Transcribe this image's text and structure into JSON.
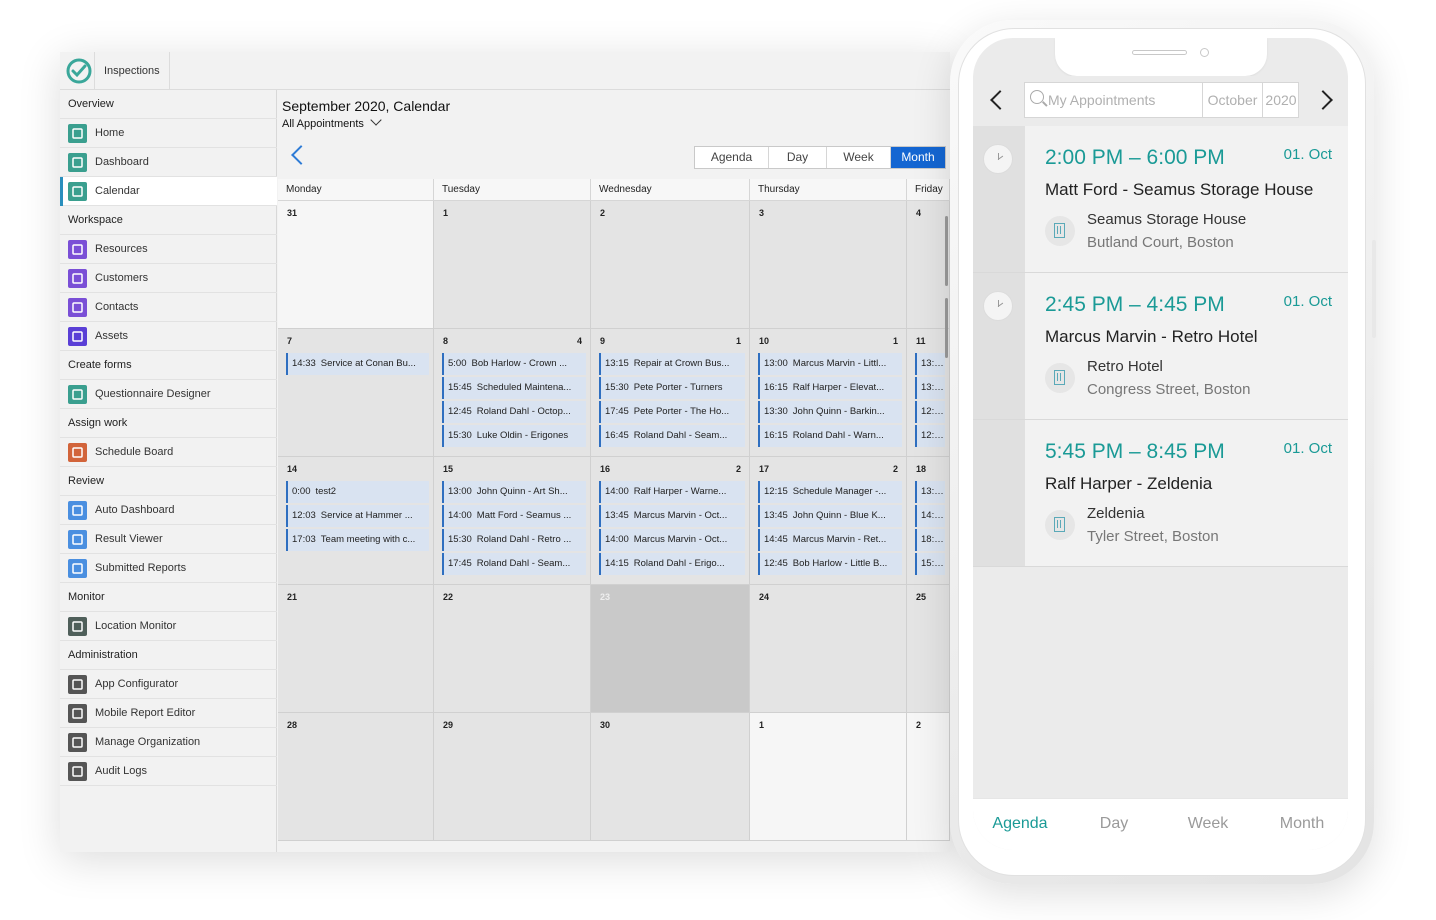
{
  "app": {
    "tab_label": "Inspections"
  },
  "sidebar": {
    "rows": [
      {
        "type": "section",
        "label": "Overview"
      },
      {
        "type": "item",
        "label": "Home",
        "icon": "home-icon",
        "color": "#3a9f8f"
      },
      {
        "type": "item",
        "label": "Dashboard",
        "icon": "dashboard-icon",
        "color": "#3a9f8f"
      },
      {
        "type": "item",
        "label": "Calendar",
        "icon": "calendar-icon",
        "color": "#3a9f8f",
        "active": true
      },
      {
        "type": "section",
        "label": "Workspace"
      },
      {
        "type": "item",
        "label": "Resources",
        "icon": "resources-icon",
        "color": "#7a4fd6"
      },
      {
        "type": "item",
        "label": "Customers",
        "icon": "customers-icon",
        "color": "#7a4fd6"
      },
      {
        "type": "item",
        "label": "Contacts",
        "icon": "contacts-icon",
        "color": "#7a4fd6"
      },
      {
        "type": "item",
        "label": "Assets",
        "icon": "assets-icon",
        "color": "#5a3fd6"
      },
      {
        "type": "section",
        "label": "Create forms"
      },
      {
        "type": "item",
        "label": "Questionnaire Designer",
        "icon": "questionnaire-icon",
        "color": "#3a9f8f"
      },
      {
        "type": "section",
        "label": "Assign work"
      },
      {
        "type": "item",
        "label": "Schedule Board",
        "icon": "schedule-board-icon",
        "color": "#d2643a"
      },
      {
        "type": "section",
        "label": "Review"
      },
      {
        "type": "item",
        "label": "Auto Dashboard",
        "icon": "auto-dashboard-icon",
        "color": "#4a8fe0"
      },
      {
        "type": "item",
        "label": "Result Viewer",
        "icon": "result-viewer-icon",
        "color": "#4a8fe0"
      },
      {
        "type": "item",
        "label": "Submitted Reports",
        "icon": "submitted-reports-icon",
        "color": "#4a8fe0"
      },
      {
        "type": "section",
        "label": "Monitor"
      },
      {
        "type": "item",
        "label": "Location Monitor",
        "icon": "location-monitor-icon",
        "color": "#4f5f5a"
      },
      {
        "type": "section",
        "label": "Administration"
      },
      {
        "type": "item",
        "label": "App Configurator",
        "icon": "app-configurator-icon",
        "color": "#555555"
      },
      {
        "type": "item",
        "label": "Mobile Report Editor",
        "icon": "mobile-report-editor-icon",
        "color": "#555555"
      },
      {
        "type": "item",
        "label": "Manage Organization",
        "icon": "manage-organization-icon",
        "color": "#555555"
      },
      {
        "type": "item",
        "label": "Audit Logs",
        "icon": "audit-logs-icon",
        "color": "#555555"
      }
    ]
  },
  "calendar": {
    "title": "September 2020, Calendar",
    "filter": "All Appointments",
    "views": [
      "Agenda",
      "Day",
      "Week",
      "Month"
    ],
    "active_view": "Month",
    "weekdays": [
      "Monday",
      "Tuesday",
      "Wednesday",
      "Thursday",
      "Friday"
    ],
    "weeks": [
      [
        {
          "day": "31",
          "shade": "light",
          "events": []
        },
        {
          "day": "1",
          "events": []
        },
        {
          "day": "2",
          "events": []
        },
        {
          "day": "3",
          "events": []
        },
        {
          "day": "4",
          "events": []
        }
      ],
      [
        {
          "day": "7",
          "events": [
            {
              "time": "14:33",
              "text": "Service at Conan Bu..."
            }
          ]
        },
        {
          "day": "8",
          "more": "4",
          "events": [
            {
              "time": "5:00",
              "text": "Bob Harlow - Crown ..."
            },
            {
              "time": "15:45",
              "text": "Scheduled Maintena..."
            },
            {
              "time": "12:45",
              "text": "Roland Dahl - Octop..."
            },
            {
              "time": "15:30",
              "text": "Luke Oldin - Erigones"
            }
          ]
        },
        {
          "day": "9",
          "more": "1",
          "events": [
            {
              "time": "13:15",
              "text": "Repair at Crown Bus..."
            },
            {
              "time": "15:30",
              "text": "Pete Porter - Turners"
            },
            {
              "time": "17:45",
              "text": "Pete Porter - The Ho..."
            },
            {
              "time": "16:45",
              "text": "Roland Dahl - Seam..."
            }
          ]
        },
        {
          "day": "10",
          "more": "1",
          "events": [
            {
              "time": "13:00",
              "text": "Marcus Marvin - Littl..."
            },
            {
              "time": "16:15",
              "text": "Ralf Harper - Elevat..."
            },
            {
              "time": "13:30",
              "text": "John Quinn - Barkin..."
            },
            {
              "time": "16:15",
              "text": "Roland Dahl - Warn..."
            }
          ]
        },
        {
          "day": "11",
          "events": [
            {
              "time": "13:00",
              "text": ""
            },
            {
              "time": "13:00",
              "text": ""
            },
            {
              "time": "12:15",
              "text": ""
            },
            {
              "time": "12:15",
              "text": ""
            }
          ]
        }
      ],
      [
        {
          "day": "14",
          "events": [
            {
              "time": "0:00",
              "text": "test2"
            },
            {
              "time": "12:03",
              "text": "Service at Hammer ..."
            },
            {
              "time": "17:03",
              "text": "Team meeting with c..."
            }
          ]
        },
        {
          "day": "15",
          "events": [
            {
              "time": "13:00",
              "text": "John Quinn - Art Sh..."
            },
            {
              "time": "14:00",
              "text": "Matt Ford - Seamus ..."
            },
            {
              "time": "15:30",
              "text": "Roland Dahl - Retro ..."
            },
            {
              "time": "17:45",
              "text": "Roland Dahl - Seam..."
            }
          ]
        },
        {
          "day": "16",
          "more": "2",
          "events": [
            {
              "time": "14:00",
              "text": "Ralf Harper - Warne..."
            },
            {
              "time": "13:45",
              "text": "Marcus Marvin - Oct..."
            },
            {
              "time": "14:00",
              "text": "Marcus Marvin - Oct..."
            },
            {
              "time": "14:15",
              "text": "Roland Dahl - Erigo..."
            }
          ]
        },
        {
          "day": "17",
          "more": "2",
          "events": [
            {
              "time": "12:15",
              "text": "Schedule Manager -..."
            },
            {
              "time": "13:45",
              "text": "John Quinn - Blue K..."
            },
            {
              "time": "14:45",
              "text": "Marcus Marvin - Ret..."
            },
            {
              "time": "12:45",
              "text": "Bob Harlow - Little B..."
            }
          ]
        },
        {
          "day": "18",
          "events": [
            {
              "time": "13:15",
              "text": ""
            },
            {
              "time": "14:30",
              "text": ""
            },
            {
              "time": "18:15",
              "text": ""
            },
            {
              "time": "15:15",
              "text": ""
            }
          ]
        }
      ],
      [
        {
          "day": "21",
          "events": []
        },
        {
          "day": "22",
          "events": []
        },
        {
          "day": "23",
          "shade": "today",
          "events": []
        },
        {
          "day": "24",
          "events": []
        },
        {
          "day": "25",
          "events": []
        }
      ],
      [
        {
          "day": "28",
          "events": []
        },
        {
          "day": "29",
          "events": []
        },
        {
          "day": "30",
          "events": []
        },
        {
          "day": "1",
          "shade": "light",
          "events": []
        },
        {
          "day": "2",
          "shade": "light",
          "events": []
        }
      ]
    ]
  },
  "mobile": {
    "search_placeholder": "My Appointments",
    "month": "October",
    "year": "2020",
    "appointments": [
      {
        "time": "2:00 PM – 6:00 PM",
        "date": "01. Oct",
        "title": "Matt Ford - Seamus Storage House",
        "place": "Seamus Storage House",
        "address": "Butland Court, Boston",
        "clock": true
      },
      {
        "time": "2:45 PM – 4:45 PM",
        "date": "01. Oct",
        "title": "Marcus Marvin - Retro Hotel",
        "place": "Retro Hotel",
        "address": "Congress Street, Boston",
        "clock": true
      },
      {
        "time": "5:45 PM – 8:45 PM",
        "date": "01. Oct",
        "title": "Ralf Harper - Zeldenia",
        "place": "Zeldenia",
        "address": "Tyler Street, Boston",
        "clock": false
      }
    ],
    "tabs": [
      "Agenda",
      "Day",
      "Week",
      "Month"
    ],
    "active_tab": "Agenda",
    "accent": "#1a9a96"
  }
}
